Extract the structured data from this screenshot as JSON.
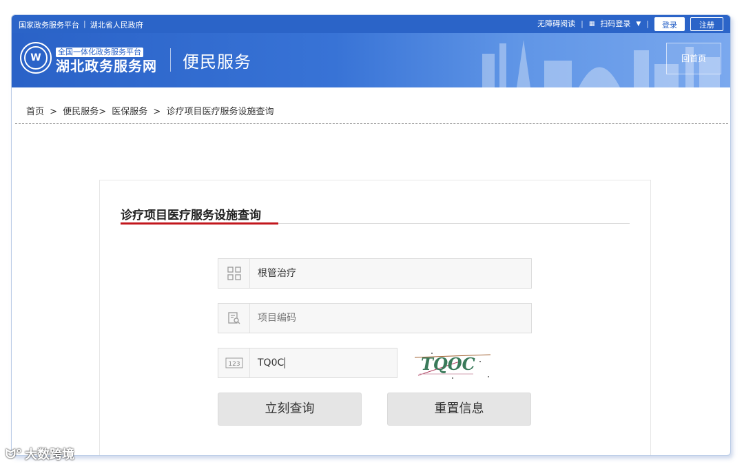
{
  "topbar": {
    "left_link_1": "国家政务服务平台",
    "left_link_2": "湖北省人民政府",
    "accessibility": "无障碍阅读",
    "scan_login": "扫码登录",
    "login": "登录",
    "register": "注册"
  },
  "header": {
    "brand_sub": "全国一体化政务服务平台",
    "brand_main": "湖北政务服务网",
    "section": "便民服务",
    "home": "回首页"
  },
  "breadcrumb": {
    "items": [
      "首页",
      ">",
      "便民服务>",
      "医保服务",
      ">",
      "诊疗项目医疗服务设施查询"
    ]
  },
  "form": {
    "title": "诊疗项目医疗服务设施查询",
    "field_name_value": "根管治疗",
    "field_code_placeholder": "项目编码",
    "captcha_input_value": "TQ0C",
    "captcha_text": "TQOC",
    "submit": "立刻查询",
    "reset": "重置信息"
  },
  "watermark": "大数跨境",
  "colors": {
    "primary": "#2b64c8",
    "accent_red": "#c2171d",
    "button_gray": "#e5e5e5"
  }
}
